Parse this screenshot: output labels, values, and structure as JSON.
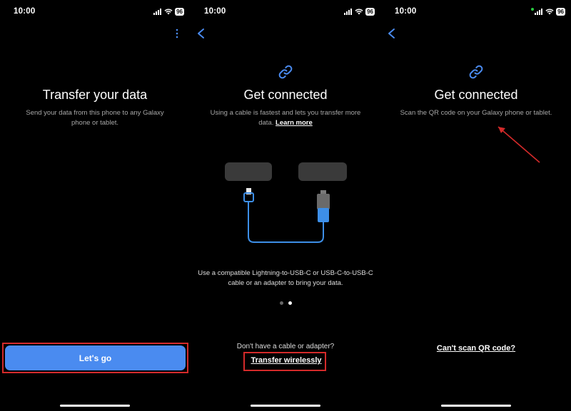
{
  "status_bar": {
    "time": "10:00",
    "battery": "96"
  },
  "screen1": {
    "title": "Transfer your data",
    "subtitle": "Send your data from this phone to any Galaxy phone or tablet.",
    "primary_button": "Let's go",
    "menu_icon": "more-vertical-icon"
  },
  "screen2": {
    "title": "Get connected",
    "subtitle": "Using a cable is fastest and lets you transfer more data.",
    "learn_more": "Learn more",
    "caption": "Use a compatible Lightning-to-USB-C or USB-C-to-USB-C cable or an adapter to bring your data.",
    "no_cable_text": "Don't have a cable or adapter?",
    "wireless_link": "Transfer wirelessly",
    "pager": {
      "count": 2,
      "active": 1
    }
  },
  "screen3": {
    "title": "Get connected",
    "subtitle": "Scan the QR code on your Galaxy phone or tablet.",
    "cant_scan_link": "Can't scan QR code?"
  },
  "colors": {
    "accent": "#4a8bf0",
    "highlight": "#d42a2a",
    "background": "#000000",
    "cable": "#3d8fe8"
  }
}
